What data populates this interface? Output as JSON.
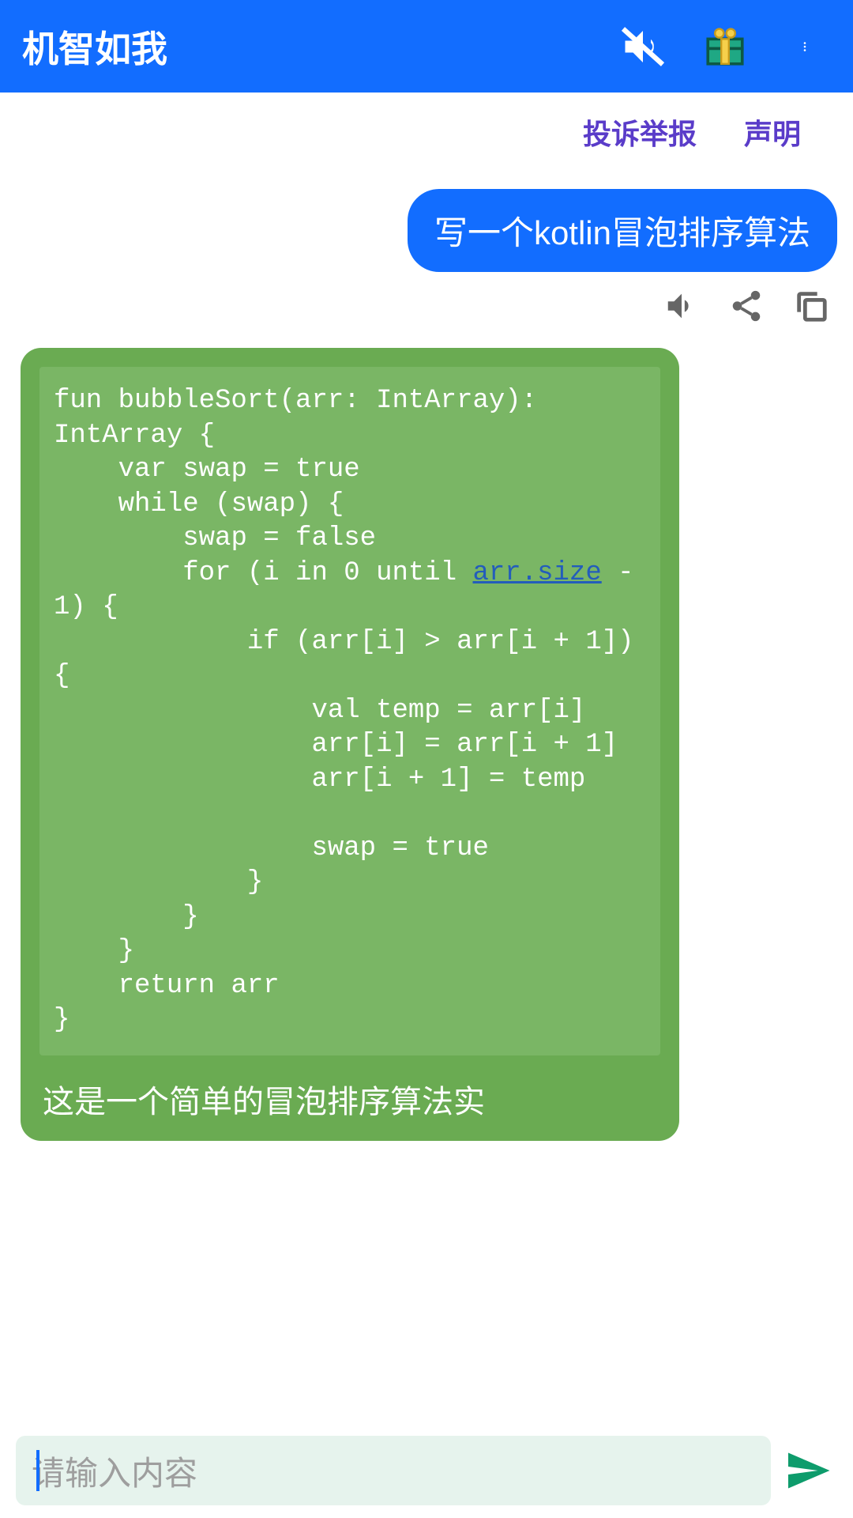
{
  "header": {
    "title": "机智如我"
  },
  "links": {
    "report": "投诉举报",
    "declare": "声明"
  },
  "user_message": "写一个kotlin冒泡排序算法",
  "code": {
    "p1": "fun bubbleSort(arr: IntArray): IntArray {\n    var swap = true\n    while (swap) {\n        swap = false\n        for (i in 0 until ",
    "link": "arr.size",
    "p2": " - 1) {\n            if (arr[i] > arr[i + 1]) {\n                val temp = arr[i]\n                arr[i] = arr[i + 1]\n                arr[i + 1] = temp\n\n                swap = true\n            }\n        }\n    }\n    return arr\n}"
  },
  "bot_after": "这是一个简单的冒泡排序算法实",
  "input": {
    "placeholder": "请输入内容"
  }
}
